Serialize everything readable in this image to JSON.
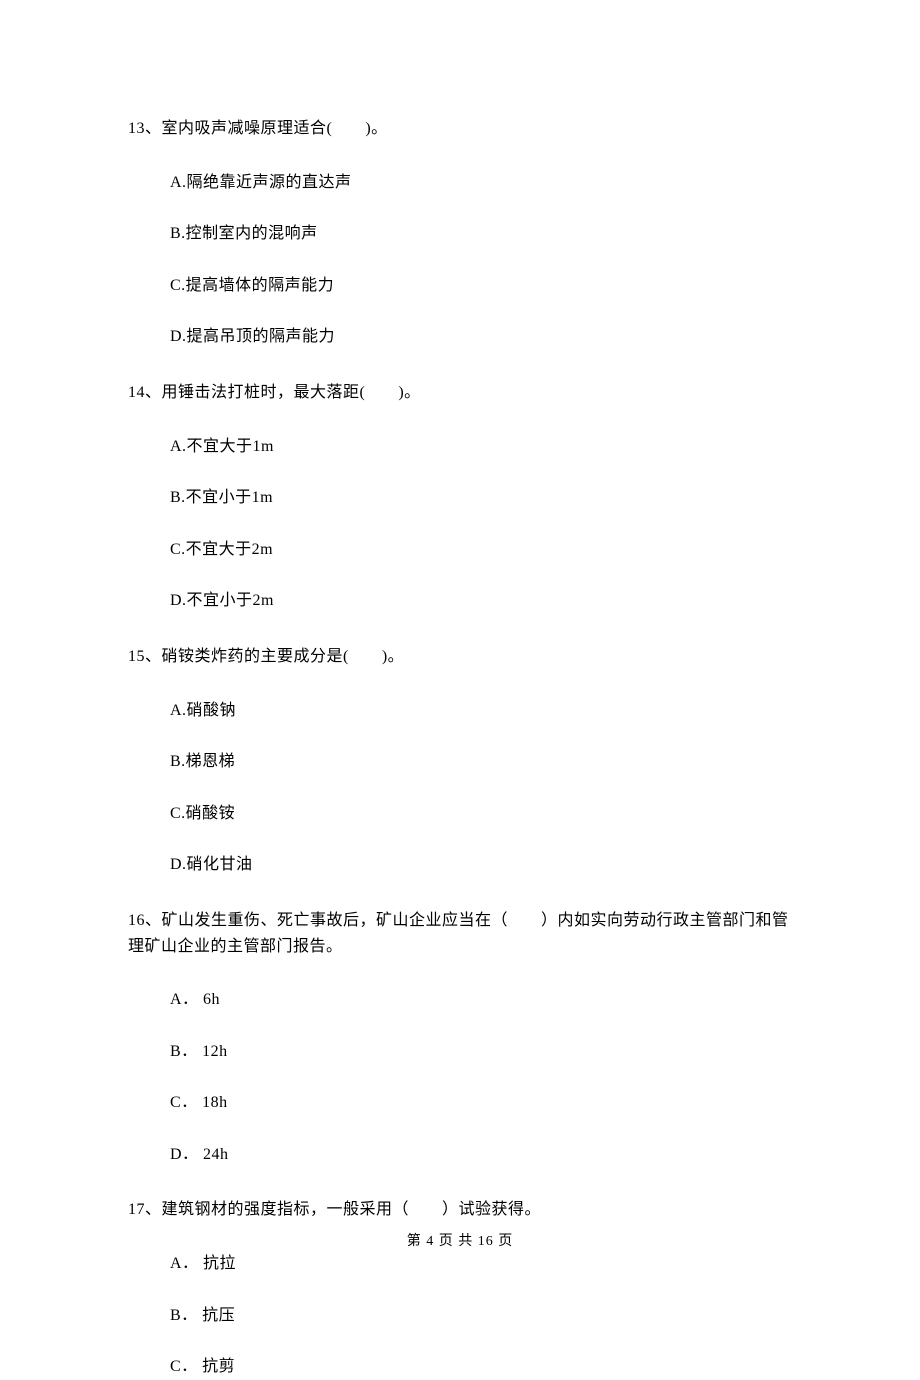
{
  "questions": [
    {
      "number": "13、",
      "text": "室内吸声减噪原理适合(　　)。",
      "options": [
        "A.隔绝靠近声源的直达声",
        "B.控制室内的混响声",
        "C.提高墙体的隔声能力",
        "D.提高吊顶的隔声能力"
      ]
    },
    {
      "number": "14、",
      "text": "用锤击法打桩时，最大落距(　　)。",
      "options": [
        "A.不宜大于1m",
        "B.不宜小于1m",
        "C.不宜大于2m",
        "D.不宜小于2m"
      ]
    },
    {
      "number": "15、",
      "text": "硝铵类炸药的主要成分是(　　)。",
      "options": [
        "A.硝酸钠",
        "B.梯恩梯",
        "C.硝酸铵",
        "D.硝化甘油"
      ]
    },
    {
      "number": "16、",
      "text": "矿山发生重伤、死亡事故后，矿山企业应当在（　　）内如实向劳动行政主管部门和管理矿山企业的主管部门报告。",
      "options": [
        "A． 6h",
        "B． 12h",
        "C． 18h",
        "D． 24h"
      ]
    },
    {
      "number": "17、",
      "text": "建筑钢材的强度指标，一般采用（　　）试验获得。",
      "options": [
        "A． 抗拉",
        "B． 抗压",
        "C． 抗剪"
      ]
    }
  ],
  "footer": "第 4 页 共 16 页"
}
